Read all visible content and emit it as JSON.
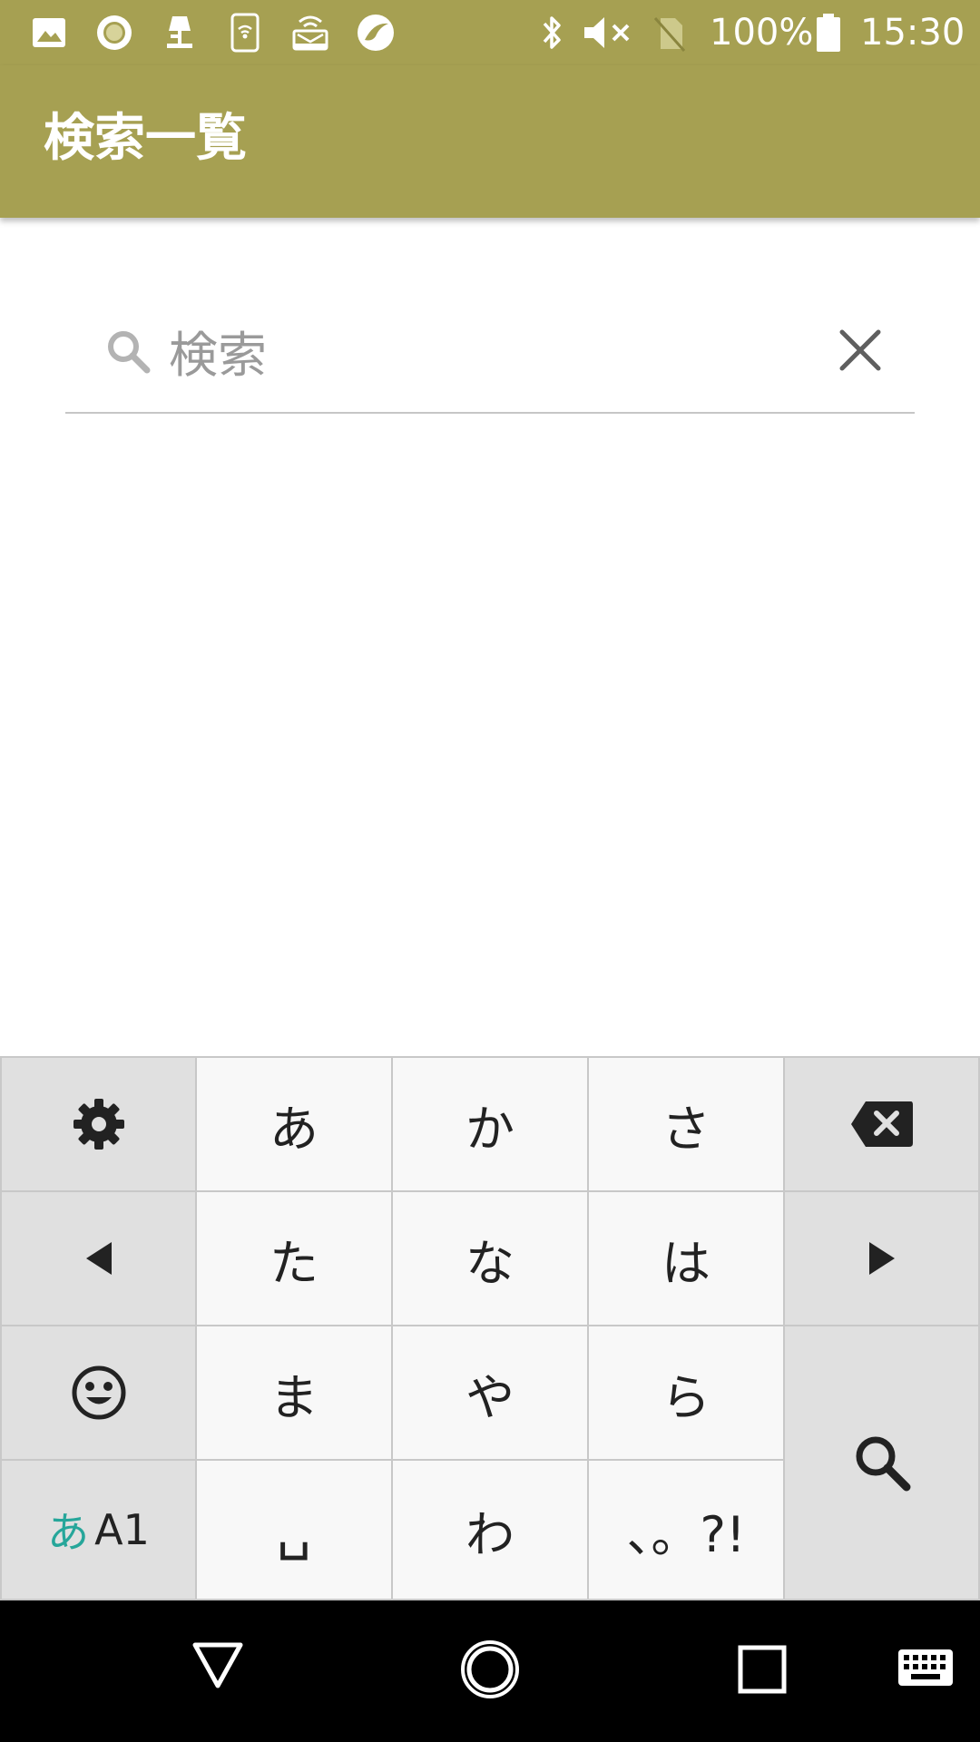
{
  "status_bar": {
    "battery_percent": "100%",
    "time": "15:30",
    "icons": [
      "image-icon",
      "circle-app-icon",
      "lamp-icon",
      "wifi-phone-icon",
      "router-icon",
      "leaf-app-icon",
      "bluetooth-icon",
      "mute-icon",
      "no-sim-icon",
      "battery-icon"
    ]
  },
  "app_bar": {
    "title": "検索一覧"
  },
  "search": {
    "placeholder": "検索",
    "value": ""
  },
  "keyboard": {
    "rows": [
      [
        "settings-icon",
        "あ",
        "か",
        "さ",
        "backspace-icon"
      ],
      [
        "left-arrow-icon",
        "た",
        "な",
        "は",
        "right-arrow-icon"
      ],
      [
        "emoji-icon",
        "ま",
        "や",
        "ら",
        "search-icon"
      ],
      [
        "mode-switch",
        "␣",
        "わ",
        "、。?!",
        ""
      ]
    ],
    "mode_label_kana": "あ",
    "mode_label_latin": "A1",
    "space_label": "␣",
    "punct_label": "、。?!",
    "key_a": "あ",
    "key_ka": "か",
    "key_sa": "さ",
    "key_ta": "た",
    "key_na": "な",
    "key_ha": "は",
    "key_ma": "ま",
    "key_ya": "や",
    "key_ra": "ら",
    "key_wa": "わ",
    "accent_color": "#26a69a"
  },
  "colors": {
    "primary": "#a6a052",
    "keyboard_bg": "#c8c8c8",
    "key_bg": "#f8f8f8",
    "func_key_bg": "#e0e0e0"
  },
  "nav_bar": {
    "icons": [
      "back-icon",
      "home-icon",
      "recents-icon",
      "keyboard-icon"
    ]
  }
}
